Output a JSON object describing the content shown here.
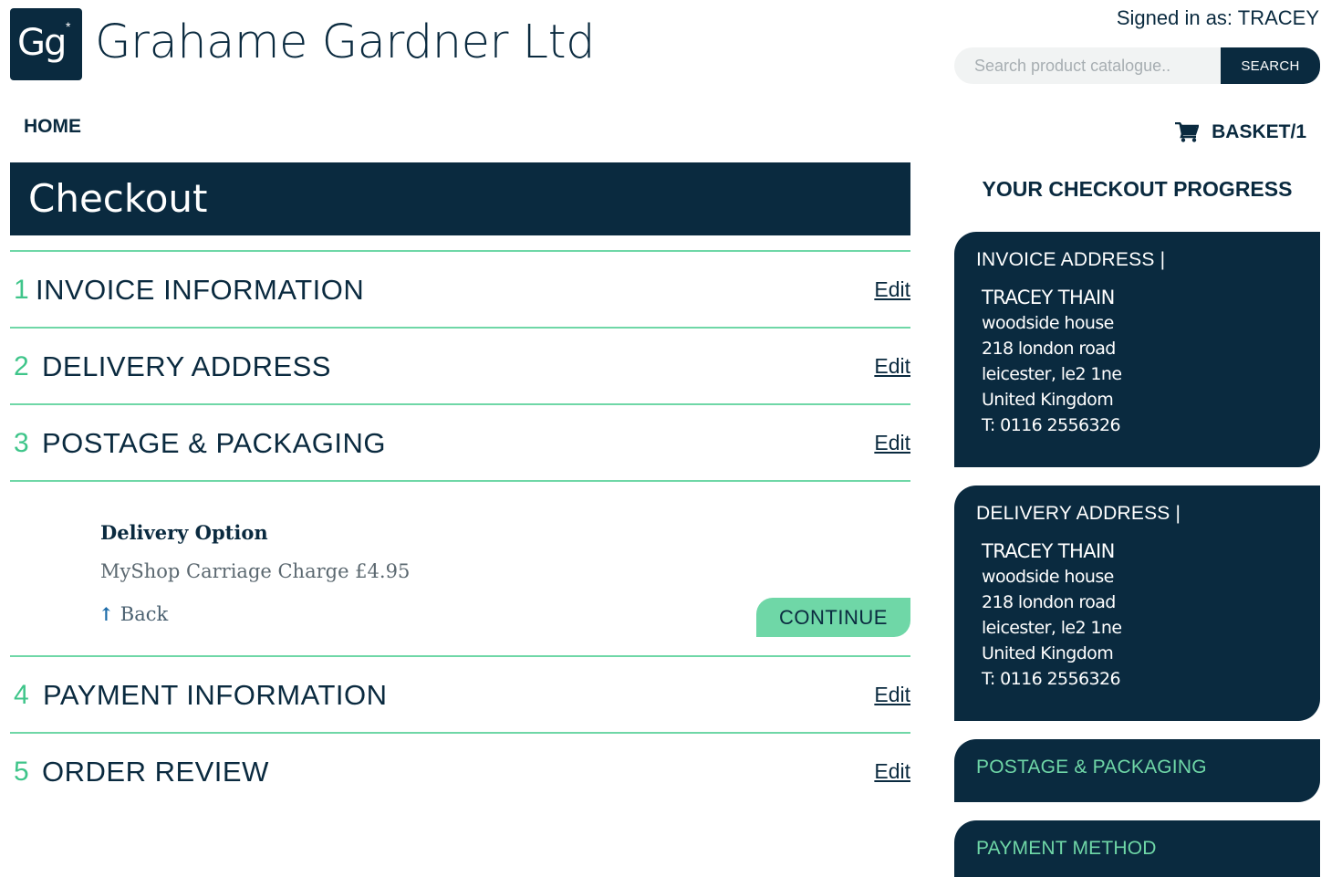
{
  "brand": {
    "logo_text": "Gg",
    "logo_mark": "*",
    "name": "Grahame Gardner Ltd"
  },
  "header": {
    "signed_in": "Signed in as: TRACEY",
    "search_placeholder": "Search product catalogue..",
    "search_button": "SEARCH",
    "home_link": "HOME",
    "basket_label": "BASKET/1",
    "basket_icon": "cart-icon"
  },
  "checkout": {
    "title": "Checkout",
    "steps": [
      {
        "number": "1",
        "title": "INVOICE INFORMATION",
        "edit": "Edit"
      },
      {
        "number": "2",
        "title": "DELIVERY ADDRESS",
        "edit": "Edit"
      },
      {
        "number": "3",
        "title": "POSTAGE & PACKAGING",
        "edit": "Edit"
      },
      {
        "number": "4",
        "title": "PAYMENT INFORMATION",
        "edit": "Edit"
      },
      {
        "number": "5",
        "title": "ORDER REVIEW",
        "edit": "Edit"
      }
    ],
    "postage": {
      "label": "Delivery Option",
      "option": "MyShop Carriage Charge £4.95",
      "back": "Back",
      "continue": "CONTINUE"
    }
  },
  "progress": {
    "title": "YOUR CHECKOUT PROGRESS",
    "invoice": {
      "heading": "INVOICE ADDRESS |",
      "name": "TRACEY THAIN",
      "lines": [
        "woodside house",
        "218 london road",
        "leicester, le2 1ne",
        "United Kingdom",
        "T: 0116 2556326"
      ]
    },
    "delivery": {
      "heading": "DELIVERY ADDRESS |",
      "name": "TRACEY THAIN",
      "lines": [
        "woodside house",
        "218 london road",
        "leicester, le2 1ne",
        "United Kingdom",
        "T: 0116 2556326"
      ]
    },
    "postage_heading": "POSTAGE & PACKAGING",
    "payment_heading": "PAYMENT METHOD"
  },
  "colors": {
    "navy": "#0a2a3f",
    "accent_green": "#6fd7a7",
    "step_number_green": "#3fc58a"
  }
}
